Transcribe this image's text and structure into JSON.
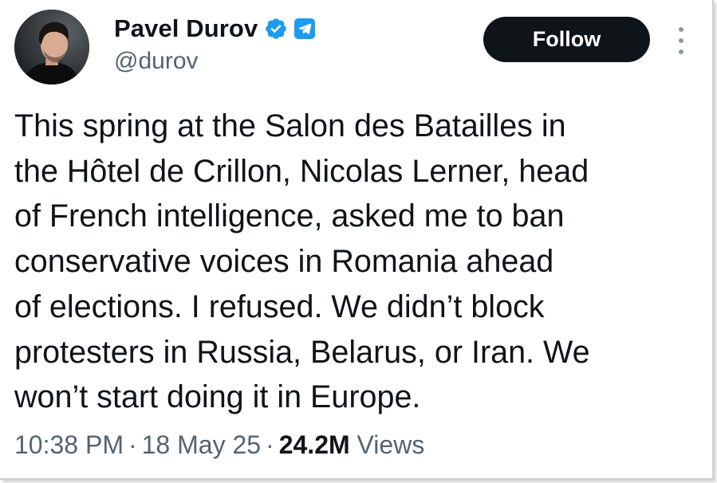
{
  "author": {
    "display_name": "Pavel Durov",
    "handle": "@durov",
    "verified_icon": "verified-badge-icon",
    "affiliation_icon": "telegram-icon"
  },
  "actions": {
    "follow_label": "Follow",
    "more_icon": "more-options-icon"
  },
  "tweet": {
    "lines": [
      "This spring at the Salon des Batailles in",
      "the Hôtel de Crillon, Nicolas Lerner, head",
      "of French intelligence, asked me to ban",
      "conservative voices in Romania ahead",
      "of elections. I refused. We didn’t block",
      "protesters in Russia, Belarus, or Iran. We",
      "won’t start doing it in Europe."
    ]
  },
  "meta": {
    "time": "10:38 PM",
    "separator": "·",
    "date": "18 May 25",
    "views_count": "24.2M",
    "views_label": "Views"
  },
  "colors": {
    "text_primary": "#0f1419",
    "text_secondary": "#536471",
    "accent_blue": "#1d9bf0",
    "button_bg": "#0f1419"
  }
}
